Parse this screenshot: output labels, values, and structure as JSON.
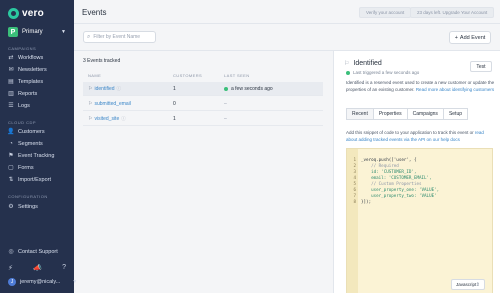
{
  "app": {
    "brand": "vero"
  },
  "sidebar": {
    "workspace": {
      "badge": "P",
      "label": "Primary"
    },
    "sections": [
      {
        "label": "CAMPAIGNS",
        "items": [
          {
            "label": "Workflows",
            "icon": "workflow-icon"
          },
          {
            "label": "Newsletters",
            "icon": "newsletter-icon"
          },
          {
            "label": "Templates",
            "icon": "template-icon"
          },
          {
            "label": "Reports",
            "icon": "report-icon"
          },
          {
            "label": "Logs",
            "icon": "log-icon"
          }
        ]
      },
      {
        "label": "CLOUD CDP",
        "items": [
          {
            "label": "Customers",
            "icon": "customer-icon"
          },
          {
            "label": "Segments",
            "icon": "segment-icon"
          },
          {
            "label": "Event Tracking",
            "icon": "event-tracking-icon"
          },
          {
            "label": "Forms",
            "icon": "forms-icon"
          },
          {
            "label": "Import/Export",
            "icon": "import-export-icon"
          }
        ]
      },
      {
        "label": "CONFIGURATION",
        "items": [
          {
            "label": "Settings",
            "icon": "settings-icon"
          }
        ]
      }
    ],
    "contact": "Contact Support",
    "user": "jeremy@nicaly..."
  },
  "header": {
    "title": "Events",
    "verify_label": "Verify your account",
    "upgrade_label": "23 days left. Upgrade Your Account"
  },
  "toolbar": {
    "filter_placeholder": "Filter by Event Name",
    "add_label": "Add Event"
  },
  "events": {
    "count_label": "3 Events tracked",
    "columns": [
      "NAME",
      "CUSTOMERS",
      "LAST SEEN"
    ],
    "rows": [
      {
        "name": "identified",
        "customers": "1",
        "last_seen": "a few seconds ago"
      },
      {
        "name": "submitted_email",
        "customers": "0",
        "last_seen": "–"
      },
      {
        "name": "visited_site",
        "customers": "1",
        "last_seen": "–"
      }
    ]
  },
  "panel": {
    "title": "Identified",
    "subtitle": "Last triggered a few seconds ago",
    "test_label": "Test",
    "description": "Identified is a reserved event used to create a new customer or update the properties of an existing customer.",
    "description_link": "Read more about identifying customers",
    "tabs": [
      "Recent",
      "Properties",
      "Campaigns",
      "Setup"
    ],
    "instructions": "Add this snippet of code to your application to track this event or",
    "instructions_link": "read about adding tracked events via the API on our help docs",
    "code_lines": [
      {
        "n": "1",
        "text": "_veroq.push(['user', {"
      },
      {
        "n": "2",
        "text": "    // Required"
      },
      {
        "n": "3",
        "text": "    id: 'CUSTOMER_ID',"
      },
      {
        "n": "4",
        "text": "    email: 'CUSTOMER_EMAIL',"
      },
      {
        "n": "5",
        "text": "    // Custom Properties"
      },
      {
        "n": "6",
        "text": "    user_property_one: 'VALUE',"
      },
      {
        "n": "7",
        "text": "    user_property_two: 'VALUE'"
      },
      {
        "n": "8",
        "text": "}]);"
      }
    ],
    "language": "Javascript"
  },
  "colors": {
    "sidebar": "#25314d",
    "accent": "#3a86c8",
    "online": "#3bbf7a",
    "code_bg": "#fbf3d5"
  }
}
